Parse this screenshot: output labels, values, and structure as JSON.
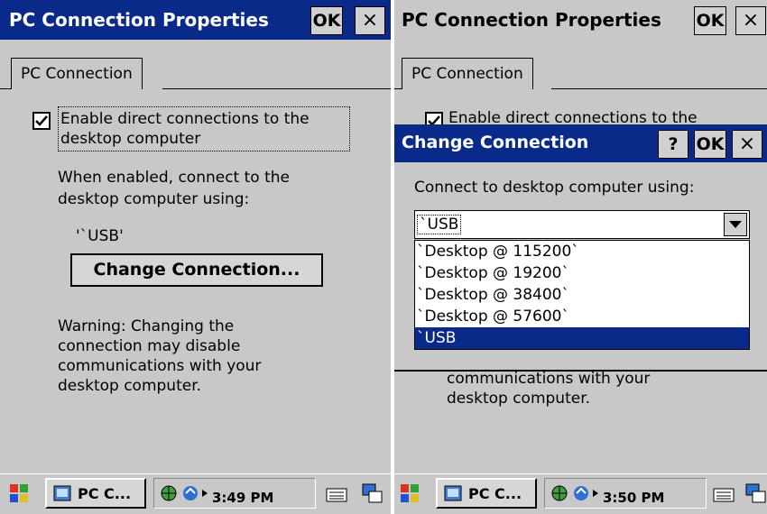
{
  "left": {
    "window_title": "PC Connection Properties",
    "ok_label": "OK",
    "close_label": "×",
    "tab_label": "PC Connection",
    "checkbox_label_line1": "Enable direct connections to the",
    "checkbox_label_line2": "desktop computer",
    "checkbox_checked": true,
    "desc_line1": "When enabled, connect to the",
    "desc_line2": "desktop computer using:",
    "connection_value": "'`USB'",
    "change_button_label": "Change Connection...",
    "warning_line1": "Warning: Changing the",
    "warning_line2": "connection may disable",
    "warning_line3": "communications with your",
    "warning_line4": "desktop computer.",
    "taskbar_task_label": "PC C...",
    "clock": "3:49 PM"
  },
  "right": {
    "window_title": "PC Connection Properties",
    "ok_label": "OK",
    "close_label": "×",
    "tab_label": "PC Connection",
    "checkbox_label_partial": "Enable direct connections to the",
    "dialog": {
      "title": "Change Connection",
      "help_label": "?",
      "ok_label": "OK",
      "close_label": "×",
      "prompt": "Connect to desktop computer using:",
      "selected_value": "`USB",
      "options": [
        "`Desktop @ 115200`",
        "`Desktop @ 19200`",
        "`Desktop @ 38400`",
        "`Desktop @ 57600`",
        "`USB"
      ],
      "selected_index": 4
    },
    "warning_line3": "communications with your",
    "warning_line4": "desktop computer.",
    "taskbar_task_label": "PC C...",
    "clock": "3:50 PM"
  },
  "colors": {
    "title_active": "#0a2a8a",
    "window_bg": "#c8c8c8",
    "selection": "#0a2a8a"
  }
}
